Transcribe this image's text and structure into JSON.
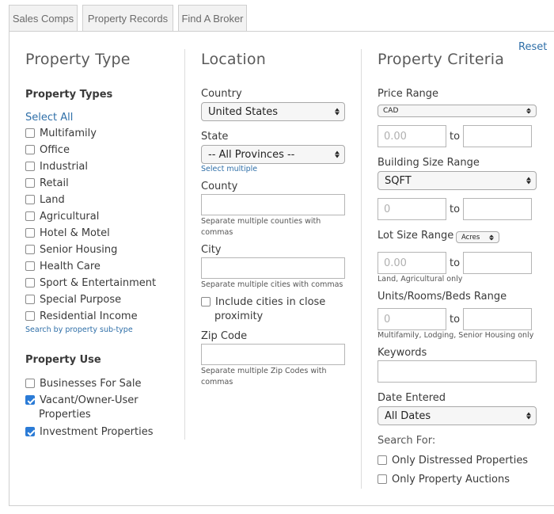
{
  "tabs": [
    "Sales Comps",
    "Property Records",
    "Find A Broker"
  ],
  "reset_label": "Reset",
  "property_type": {
    "heading": "Property Type",
    "types_heading": "Property Types",
    "select_all": "Select All",
    "types": [
      {
        "label": "Multifamily",
        "checked": false
      },
      {
        "label": "Office",
        "checked": false
      },
      {
        "label": "Industrial",
        "checked": false
      },
      {
        "label": "Retail",
        "checked": false
      },
      {
        "label": "Land",
        "checked": false
      },
      {
        "label": "Agricultural",
        "checked": false
      },
      {
        "label": "Hotel & Motel",
        "checked": false
      },
      {
        "label": "Senior Housing",
        "checked": false
      },
      {
        "label": "Health Care",
        "checked": false
      },
      {
        "label": "Sport & Entertainment",
        "checked": false
      },
      {
        "label": "Special Purpose",
        "checked": false
      },
      {
        "label": "Residential Income",
        "checked": false
      }
    ],
    "subtype_link": "Search by property sub-type",
    "use_heading": "Property Use",
    "uses": [
      {
        "label": "Businesses For Sale",
        "checked": false
      },
      {
        "label": "Vacant/Owner-User",
        "label2": "Properties",
        "checked": true
      },
      {
        "label": "Investment Properties",
        "checked": true
      }
    ]
  },
  "location": {
    "heading": "Location",
    "country_label": "Country",
    "country_value": "United States",
    "state_label": "State",
    "state_value": "-- All Provinces --",
    "select_multiple": "Select multiple",
    "county_label": "County",
    "county_hint": "Separate multiple counties with commas",
    "city_label": "City",
    "city_hint": "Separate multiple cities with commas",
    "close_proximity_line1": "Include cities in close",
    "close_proximity_line2": "proximity",
    "zip_label": "Zip Code",
    "zip_hint": "Separate multiple Zip Codes with commas"
  },
  "criteria": {
    "heading": "Property Criteria",
    "price_label": "Price Range",
    "currency_value": "CAD",
    "price_min_placeholder": "0.00",
    "to": "to",
    "building_label": "Building Size Range",
    "building_unit": "SQFT",
    "building_min_placeholder": "0",
    "lot_label": "Lot Size Range",
    "lot_unit": "Acres",
    "lot_min_placeholder": "0.00",
    "lot_hint": "Land, Agricultural only",
    "units_label": "Units/Rooms/Beds Range",
    "units_min_placeholder": "0",
    "units_hint": "Multifamily, Lodging, Senior Housing only",
    "keywords_label": "Keywords",
    "date_label": "Date Entered",
    "date_value": "All Dates",
    "search_for_label": "Search For:",
    "distressed_label": "Only Distressed Properties",
    "auctions_label": "Only Property Auctions"
  }
}
